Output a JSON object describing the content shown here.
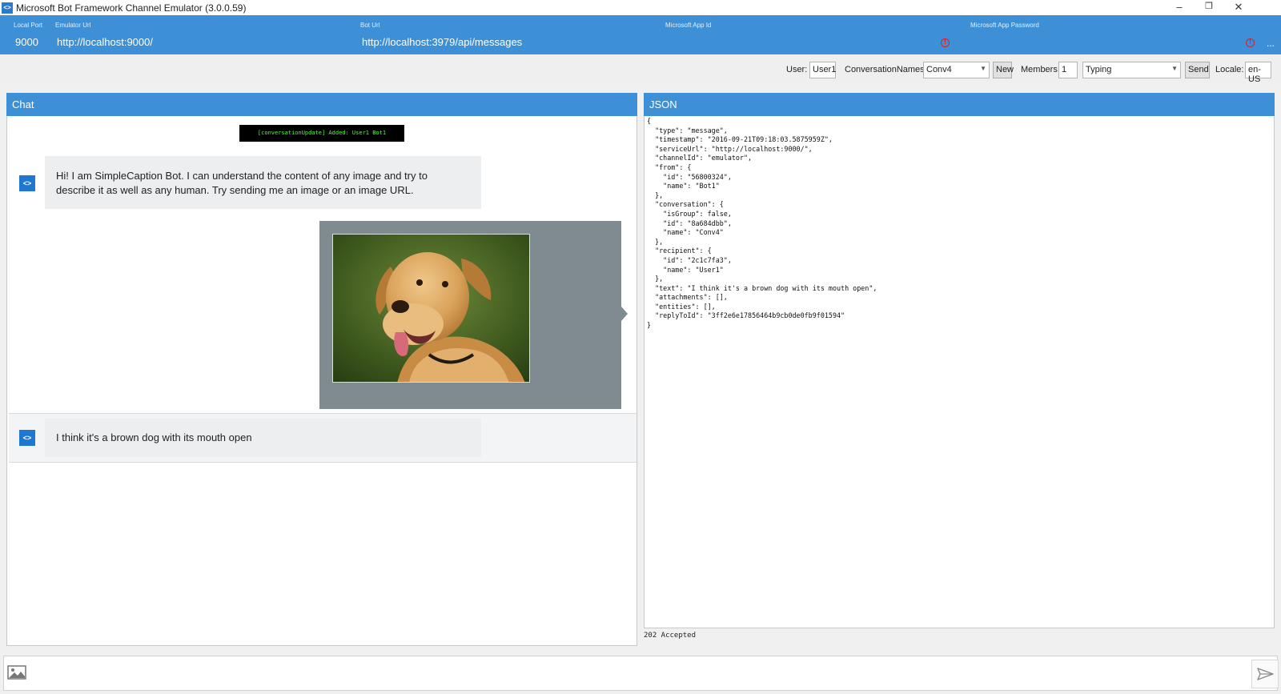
{
  "window": {
    "title": "Microsoft Bot Framework Channel Emulator (3.0.0.59)",
    "minimize": "–",
    "maximize": "❐",
    "close": "✕"
  },
  "config": {
    "local_port_label": "Local Port",
    "local_port": "9000",
    "emulator_url_label": "Emulator Url",
    "emulator_url": "http://localhost:9000/",
    "bot_url_label": "Bot Url",
    "bot_url": "http://localhost:3979/api/messages",
    "app_id_label": "Microsoft App Id",
    "app_password_label": "Microsoft App Password",
    "more": "..."
  },
  "toolbar": {
    "user_label": "User:",
    "user_value": "User1",
    "conv_label": "ConversationNames:",
    "conv_value": "Conv4",
    "new_label": "New",
    "members_label": "Members:",
    "members_value": "1",
    "activity_value": "Typing",
    "send_label": "Send",
    "locale_label": "Locale:",
    "locale_value": "en-US"
  },
  "chat": {
    "title": "Chat",
    "system_message": "[conversationUpdate] Added: User1 Bot1",
    "messages": [
      {
        "text_line1": "Hi! I am SimpleCaption Bot. I can understand the content of any image and try to",
        "text_line2": "describe it as well as any human. Try sending me an image or an image URL."
      },
      {
        "text": "I think it's a brown dog with its mouth open"
      }
    ]
  },
  "json": {
    "title": "JSON",
    "content": "{\n  \"type\": \"message\",\n  \"timestamp\": \"2016-09-21T09:18:03.5875959Z\",\n  \"serviceUrl\": \"http://localhost:9000/\",\n  \"channelId\": \"emulator\",\n  \"from\": {\n    \"id\": \"56800324\",\n    \"name\": \"Bot1\"\n  },\n  \"conversation\": {\n    \"isGroup\": false,\n    \"id\": \"8a684dbb\",\n    \"name\": \"Conv4\"\n  },\n  \"recipient\": {\n    \"id\": \"2c1c7fa3\",\n    \"name\": \"User1\"\n  },\n  \"text\": \"I think it's a brown dog with its mouth open\",\n  \"attachments\": [],\n  \"entities\": [],\n  \"replyToId\": \"3ff2e6e17856464b9cb0de0fb9f01594\"\n}",
    "status": "202 Accepted"
  },
  "composer": {
    "placeholder": ""
  },
  "icons": {
    "bot_avatar": "<>",
    "alert": "!"
  },
  "colors": {
    "accent": "#3d8fd6",
    "alert": "#e02020",
    "terminal_green": "#4cff34"
  }
}
